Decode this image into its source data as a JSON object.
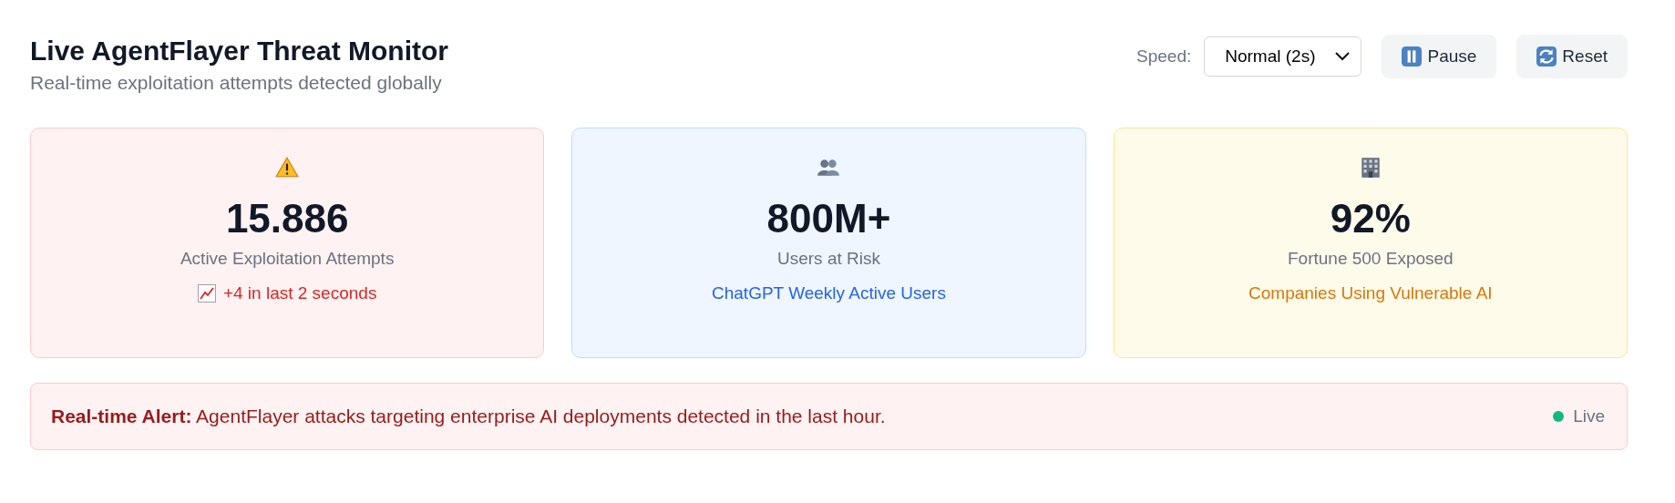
{
  "header": {
    "title": "Live AgentFlayer Threat Monitor",
    "subtitle": "Real-time exploitation attempts detected globally"
  },
  "controls": {
    "speed_label": "Speed:",
    "speed_value": "Normal (2s)",
    "buttons": [
      {
        "kind": "pause",
        "label": "Pause"
      },
      {
        "kind": "reset",
        "label": "Reset"
      }
    ]
  },
  "cards": [
    {
      "kind": "danger",
      "value": "15.886",
      "label": "Active Exploitation Attempts",
      "note": "+4 in last 2 seconds"
    },
    {
      "kind": "info",
      "value": "800M+",
      "label": "Users at Risk",
      "note": "ChatGPT Weekly Active Users"
    },
    {
      "kind": "warning",
      "value": "92%",
      "label": "Fortune 500 Exposed",
      "note": "Companies Using Vulnerable AI"
    }
  ],
  "alert": {
    "text": "**Real-time Alert:** AgentFlayer attacks targeting enterprise AI deployments detected in the last hour.",
    "status": "Live",
    "color": "#10b981"
  }
}
